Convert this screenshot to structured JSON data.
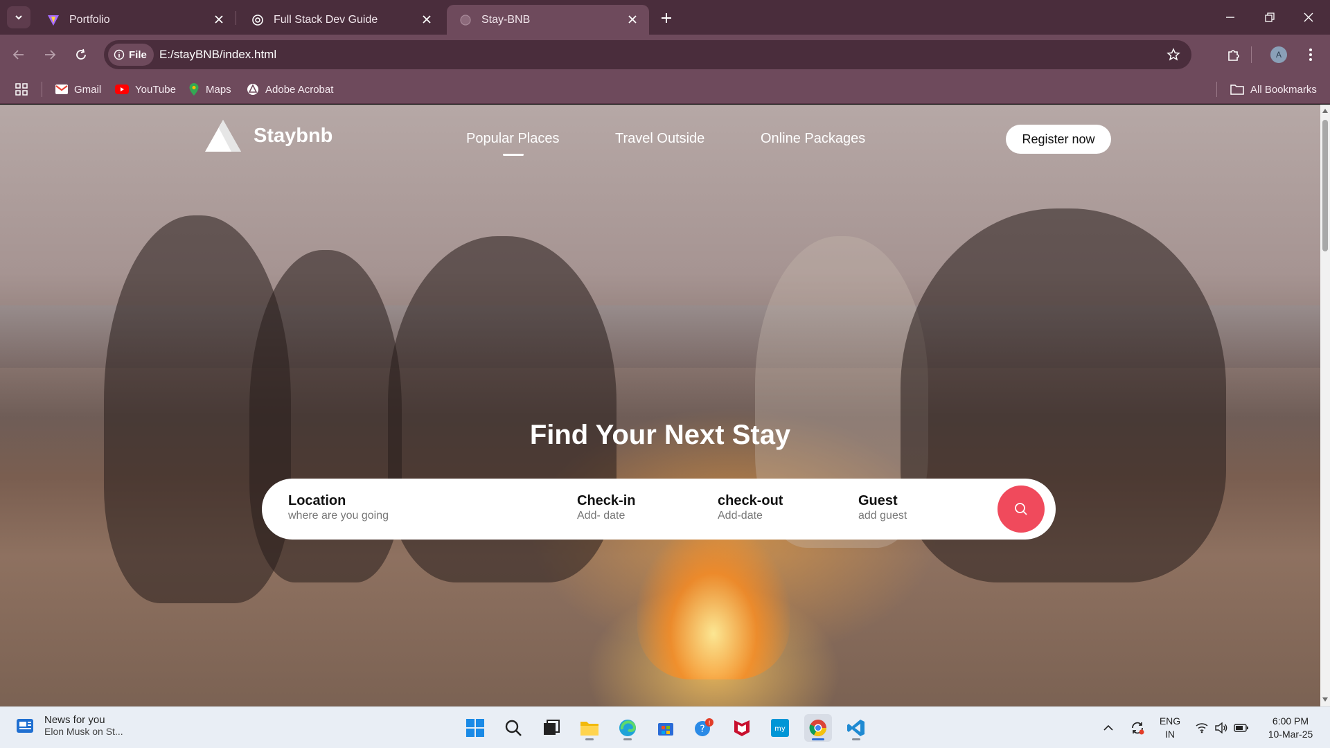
{
  "browser": {
    "tabs": [
      {
        "title": "Portfolio",
        "icon": "vite-logo-icon",
        "active": false
      },
      {
        "title": "Full Stack Dev Guide",
        "icon": "openai-logo-icon",
        "active": false
      },
      {
        "title": "Stay-BNB",
        "icon": "globe-icon",
        "active": true
      }
    ],
    "address": {
      "chip_label": "File",
      "url": "E:/stayBNB/index.html"
    },
    "bookmarks": [
      {
        "label": "Gmail",
        "icon": "gmail-icon"
      },
      {
        "label": "YouTube",
        "icon": "youtube-icon"
      },
      {
        "label": "Maps",
        "icon": "maps-icon"
      },
      {
        "label": "Adobe Acrobat",
        "icon": "acrobat-icon"
      }
    ],
    "all_bookmarks_label": "All Bookmarks",
    "profile_initial": "A"
  },
  "site": {
    "logo_text": "Staybnb",
    "nav": [
      {
        "label": "Popular Places",
        "active": true
      },
      {
        "label": "Travel Outside",
        "active": false
      },
      {
        "label": "Online Packages",
        "active": false
      }
    ],
    "register_label": "Register now",
    "hero_title": "Find Your Next Stay",
    "search": {
      "fields": [
        {
          "label": "Location",
          "sub": "where are you going"
        },
        {
          "label": "Check-in",
          "sub": "Add- date"
        },
        {
          "label": "check-out",
          "sub": "Add-date"
        },
        {
          "label": "Guest",
          "sub": "add guest"
        }
      ],
      "button_icon": "search-icon",
      "button_color": "#f04a5c"
    }
  },
  "taskbar": {
    "news": {
      "title": "News for you",
      "sub": "Elon Musk on St..."
    },
    "apps": [
      "start-icon",
      "search-icon",
      "task-view-icon",
      "file-explorer-icon",
      "edge-icon",
      "store-icon",
      "get-help-icon",
      "mcafee-icon",
      "myhp-icon",
      "chrome-icon",
      "vscode-icon"
    ],
    "language": {
      "line1": "ENG",
      "line2": "IN"
    },
    "clock": {
      "time": "6:00 PM",
      "date": "10-Mar-25"
    }
  },
  "colors": {
    "tabbar": "#4a2d3c",
    "toolbar": "#6e4a5c",
    "accent": "#f04a5c"
  }
}
